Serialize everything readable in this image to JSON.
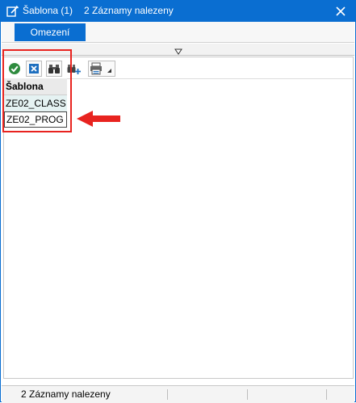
{
  "window": {
    "title": "Šablona (1)",
    "subtitle": "2 Záznamy nalezeny"
  },
  "tabs": [
    {
      "label": "Omezení",
      "active": true
    }
  ],
  "toolbar": {
    "buttons": [
      {
        "name": "confirm",
        "icon": "checkmark-icon"
      },
      {
        "name": "cancel",
        "icon": "close-x-icon"
      },
      {
        "name": "find",
        "icon": "binoculars-icon"
      },
      {
        "name": "find-next",
        "icon": "binoculars-plus-icon"
      },
      {
        "name": "print",
        "icon": "printer-icon"
      }
    ]
  },
  "table": {
    "header": "Šablona",
    "rows": [
      "ZE02_CLASS",
      "ZE02_PROG"
    ],
    "selected_row": "ZE02_PROG"
  },
  "status": {
    "text": "2 Záznamy nalezeny"
  },
  "colors": {
    "accent": "#0a6ed1",
    "annotation": "#e8231f",
    "row_alt": "#e5f2f2"
  }
}
